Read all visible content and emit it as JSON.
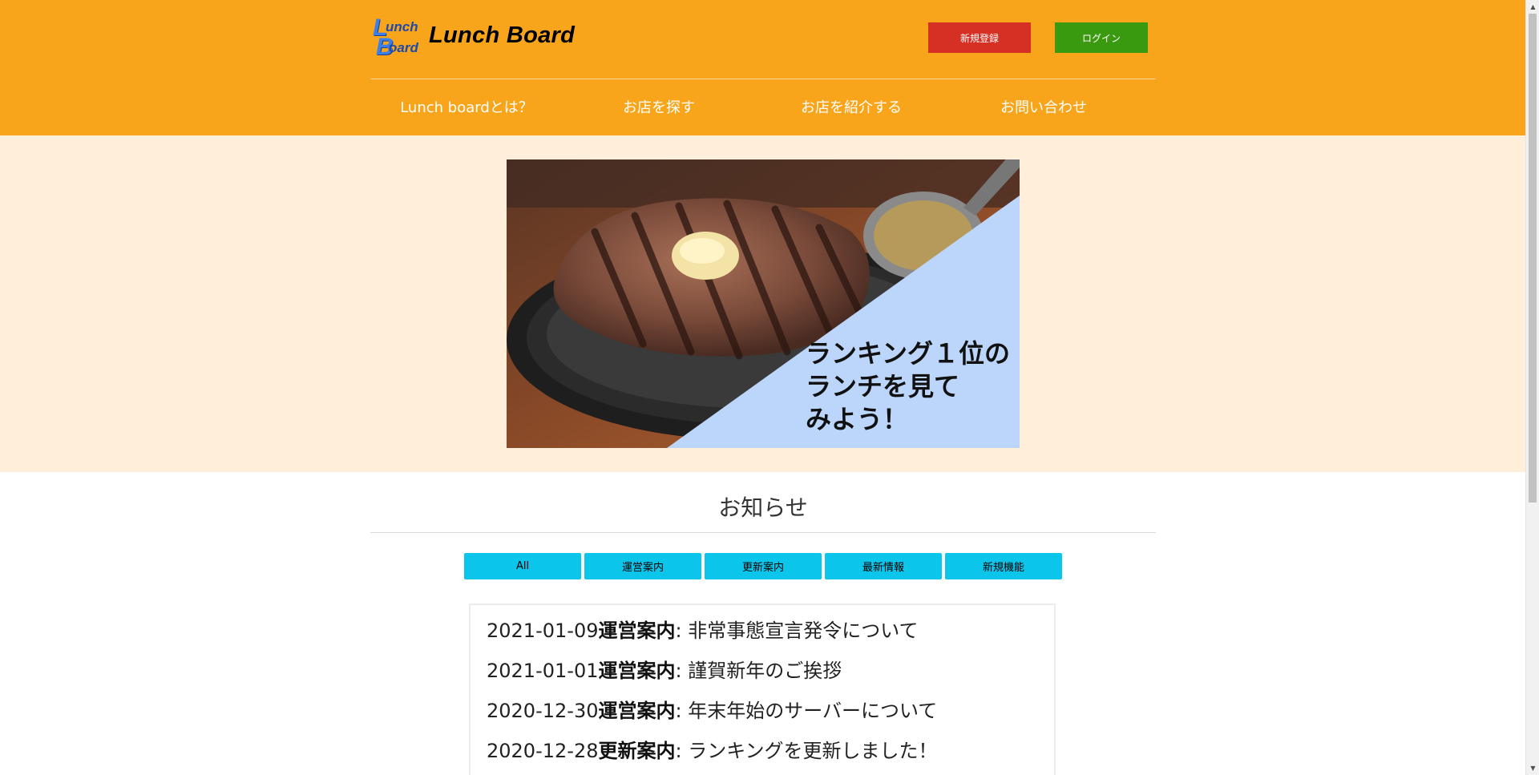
{
  "header": {
    "logo_mark": [
      "L",
      "unch",
      "B",
      "oard"
    ],
    "logo_text": "Lunch Board",
    "register_label": "新規登録",
    "login_label": "ログイン",
    "nav": [
      {
        "label": "Lunch boardとは？"
      },
      {
        "label": "お店を探す"
      },
      {
        "label": "お店を紹介する"
      },
      {
        "label": "お問い合わせ"
      }
    ]
  },
  "hero": {
    "caption_lines": [
      "ランキング１位の",
      "ランチを見て",
      "みよう！"
    ]
  },
  "news": {
    "title": "お知らせ",
    "filters": [
      "All",
      "運営案内",
      "更新案内",
      "最新情報",
      "新規機能"
    ],
    "items": [
      {
        "date": "2021-01-09",
        "category": "運営案内",
        "separator": ": ",
        "title": "非常事態宣言発令について"
      },
      {
        "date": "2021-01-01",
        "category": "運営案内",
        "separator": ": ",
        "title": "謹賀新年のご挨拶"
      },
      {
        "date": "2020-12-30",
        "category": "運営案内",
        "separator": ": ",
        "title": "年末年始のサーバーについて"
      },
      {
        "date": "2020-12-28",
        "category": "更新案内",
        "separator": ": ",
        "title": "ランキングを更新しました！"
      }
    ]
  },
  "colors": {
    "header_bg": "#f9a51b",
    "hero_bg": "#ffeed9",
    "register_btn": "#d62f24",
    "login_btn": "#3a9a0f",
    "filter_btn": "#0cc5eb",
    "hero_overlay": "#bcd6fb"
  },
  "icons": [
    "scroll-up-arrow-icon",
    "scroll-down-arrow-icon"
  ]
}
